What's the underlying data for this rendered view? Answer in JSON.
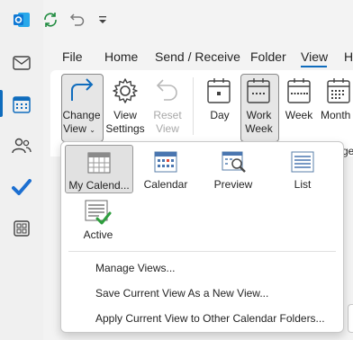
{
  "app": {
    "name": "Outlook"
  },
  "qat": {
    "icons": [
      "outlook-logo-icon",
      "sync-icon",
      "undo-icon",
      "customize-qat-icon"
    ]
  },
  "rail": {
    "items": [
      "mail-icon",
      "calendar-icon",
      "people-icon",
      "todo-icon",
      "apps-icon"
    ]
  },
  "tabs": [
    "File",
    "Home",
    "Send / Receive",
    "Folder",
    "View",
    "H"
  ],
  "active_tab": "View",
  "ribbon": {
    "change_view": {
      "line1": "Change",
      "line2": "View"
    },
    "view_settings": {
      "line1": "View",
      "line2": "Settings"
    },
    "reset_view": {
      "line1": "Reset",
      "line2": "View"
    },
    "day": "Day",
    "work_week": {
      "line1": "Work",
      "line2": "Week"
    },
    "week": "Week",
    "month": "Month",
    "arrange_partial": "ge"
  },
  "dropdown": {
    "views": [
      {
        "label": "My Calend...",
        "selected": true
      },
      {
        "label": "Calendar"
      },
      {
        "label": "Preview"
      },
      {
        "label": "List"
      },
      {
        "label": "Active"
      }
    ],
    "menu_items": [
      "Manage Views...",
      "Save Current View As a New View...",
      "Apply Current View to Other Calendar Folders..."
    ]
  },
  "colors": {
    "accent": "#0f6cbd",
    "outlook_blue": "#0f78d4",
    "sync_green": "#1e8a3e",
    "check_green": "#2e9e3e"
  }
}
